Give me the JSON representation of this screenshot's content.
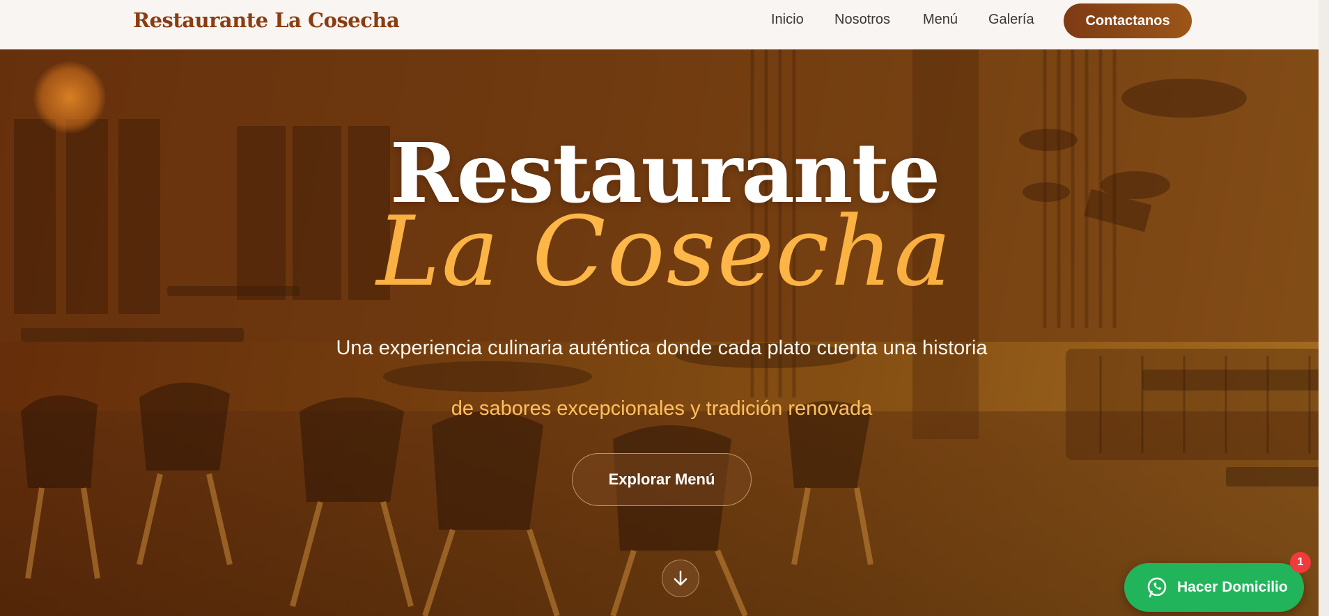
{
  "header": {
    "brand": "Restaurante La Cosecha",
    "nav": {
      "inicio": "Inicio",
      "nosotros": "Nosotros",
      "menu": "Menú",
      "galeria": "Galería"
    },
    "cta": "Contactanos"
  },
  "hero": {
    "title": "Restaurante",
    "script_title": "La Cosecha",
    "tagline": "Una experiencia culinaria auténtica donde cada plato cuenta una historia",
    "subtagline": "de sabores excepcionales y tradición renovada",
    "explore_button": "Explorar Menú",
    "scroll_icon": "arrow-down-icon"
  },
  "floating": {
    "whatsapp_label": "Hacer Domicilio",
    "whatsapp_icon": "whatsapp-icon",
    "badge_count": "1"
  },
  "colors": {
    "brand": "#8a3d10",
    "accent": "#f5a83c",
    "cta_start": "#7e3a14",
    "cta_end": "#9c5618",
    "whatsapp": "#22b45a",
    "badge": "#ef3b3b"
  }
}
